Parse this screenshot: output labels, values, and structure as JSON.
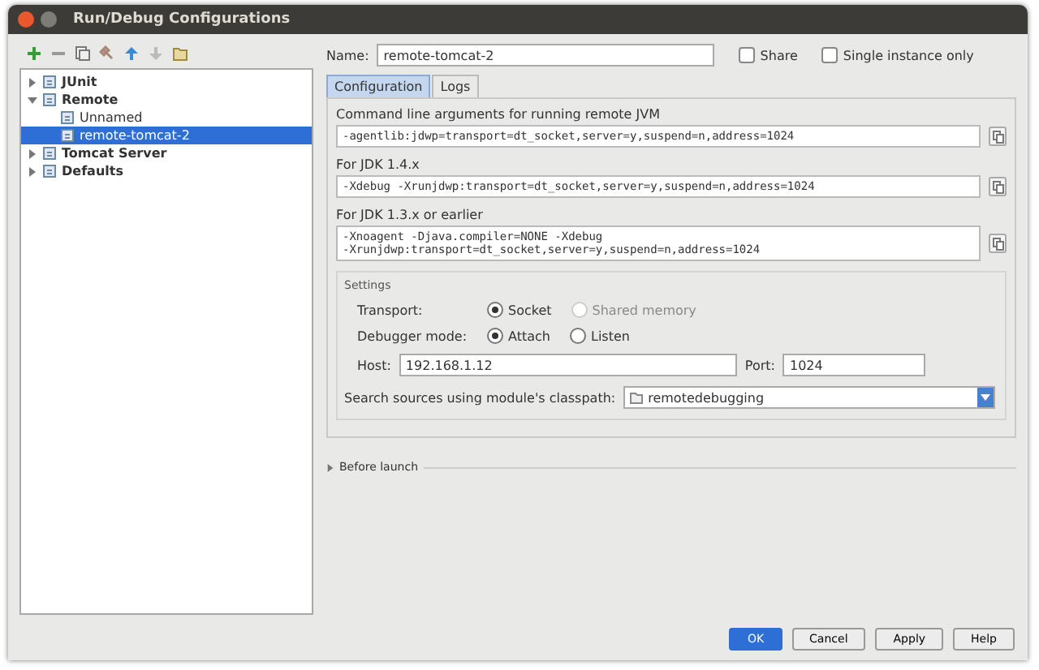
{
  "window": {
    "title": "Run/Debug Configurations"
  },
  "toolbar": [
    {
      "kind": "add"
    },
    {
      "kind": "remove"
    },
    {
      "kind": "copy"
    },
    {
      "kind": "wrench"
    },
    {
      "kind": "up"
    },
    {
      "kind": "down"
    },
    {
      "kind": "folder"
    }
  ],
  "tree": [
    {
      "label": "JUnit",
      "expanded": false,
      "selected": false,
      "bold": true
    },
    {
      "label": "Remote",
      "expanded": true,
      "selected": false,
      "bold": true,
      "children": [
        {
          "label": "Unnamed",
          "selected": false,
          "bold": false
        },
        {
          "label": "remote-tomcat-2",
          "selected": true,
          "bold": false
        }
      ]
    },
    {
      "label": "Tomcat Server",
      "expanded": false,
      "selected": false,
      "bold": true
    },
    {
      "label": "Defaults",
      "expanded": false,
      "selected": false,
      "bold": true
    }
  ],
  "name_field": {
    "label": "Name:",
    "value": "remote-tomcat-2"
  },
  "options": [
    {
      "label": "Share",
      "checked": false
    },
    {
      "label": "Single instance only",
      "checked": false
    }
  ],
  "tabs": [
    {
      "label": "Configuration",
      "selected": true
    },
    {
      "label": "Logs",
      "selected": false
    }
  ],
  "arguments": [
    {
      "label": "Command line arguments for running remote JVM",
      "lines": [
        "-agentlib:jdwp=transport=dt_socket,server=y,suspend=n,address=1024"
      ]
    },
    {
      "label": "For JDK 1.4.x",
      "lines": [
        "-Xdebug -Xrunjdwp:transport=dt_socket,server=y,suspend=n,address=1024"
      ]
    },
    {
      "label": "For JDK 1.3.x or earlier",
      "lines": [
        "-Xnoagent -Djava.compiler=NONE -Xdebug",
        "-Xrunjdwp:transport=dt_socket,server=y,suspend=n,address=1024"
      ]
    }
  ],
  "settings": {
    "title": "Settings",
    "radio_groups": [
      {
        "label": "Transport:",
        "options": [
          {
            "label": "Socket",
            "selected": true,
            "disabled": false
          },
          {
            "label": "Shared memory",
            "selected": false,
            "disabled": true
          }
        ]
      },
      {
        "label": "Debugger mode:",
        "options": [
          {
            "label": "Attach",
            "selected": true,
            "disabled": false
          },
          {
            "label": "Listen",
            "selected": false,
            "disabled": false
          }
        ]
      }
    ],
    "host": {
      "label": "Host:",
      "value": "192.168.1.12"
    },
    "port": {
      "label": "Port:",
      "value": "1024"
    },
    "module": {
      "label": "Search sources using module's classpath:",
      "value": "remotedebugging"
    }
  },
  "before_launch": {
    "label": "Before launch",
    "expanded": false
  },
  "buttons": [
    {
      "label": "OK",
      "primary": true
    },
    {
      "label": "Cancel",
      "primary": false
    },
    {
      "label": "Apply",
      "primary": false
    },
    {
      "label": "Help",
      "primary": false
    }
  ]
}
